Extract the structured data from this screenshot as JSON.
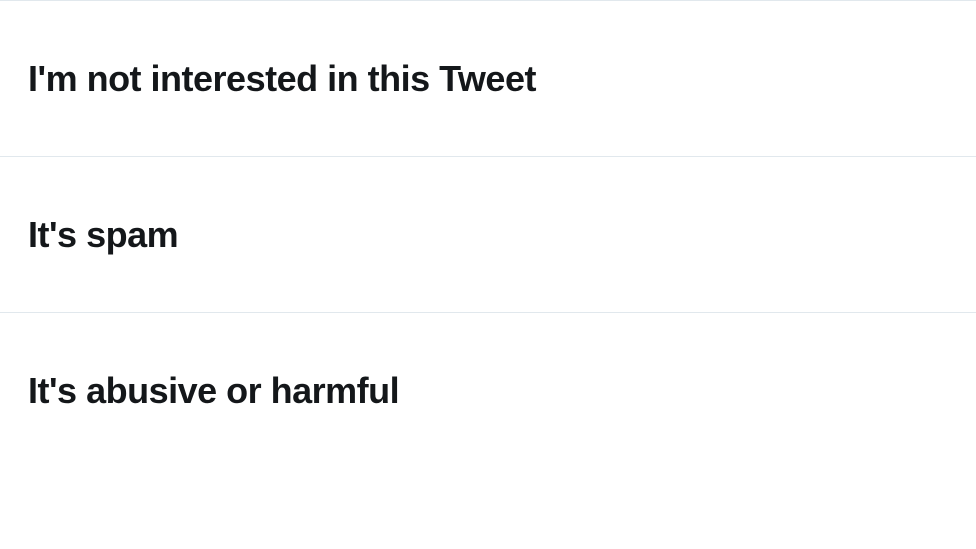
{
  "report_options": [
    {
      "label": "I'm not interested in this Tweet"
    },
    {
      "label": "It's spam"
    },
    {
      "label": "It's abusive or harmful"
    }
  ]
}
